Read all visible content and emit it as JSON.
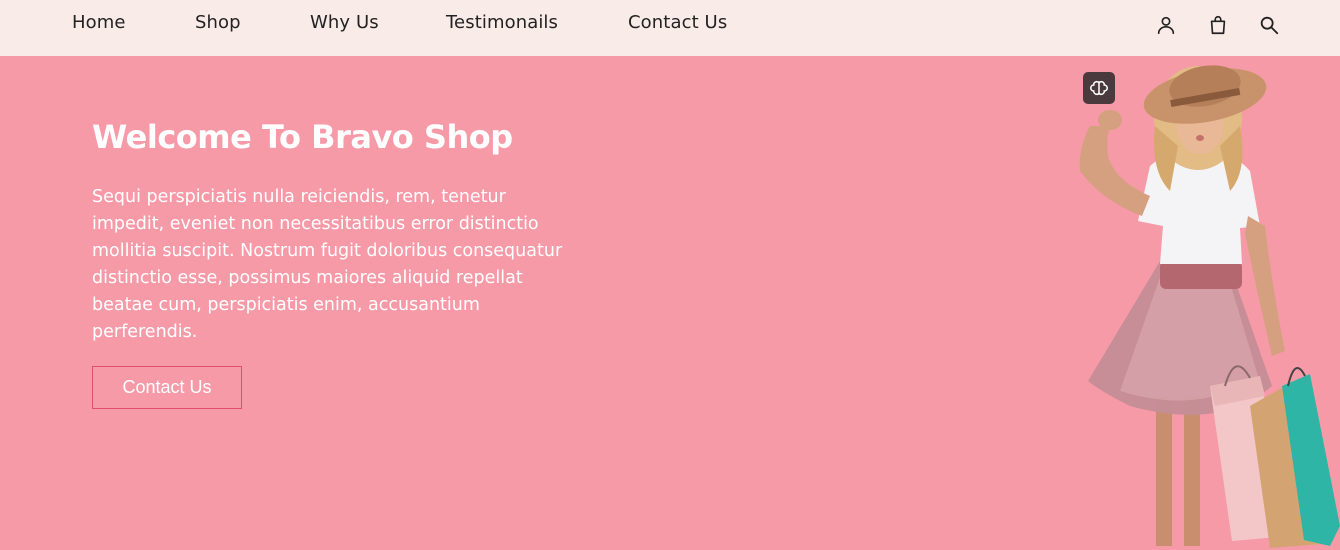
{
  "nav": {
    "links": [
      {
        "label": "Home"
      },
      {
        "label": "Shop"
      },
      {
        "label": "Why Us"
      },
      {
        "label": "Testimonails"
      },
      {
        "label": "Contact Us"
      }
    ],
    "icons": [
      "user-icon",
      "shopping-bag-icon",
      "search-icon"
    ]
  },
  "hero": {
    "title": "Welcome To Bravo Shop",
    "text": "Sequi perspiciatis nulla reiciendis, rem, tenetur impedit, eveniet non necessitatibus error distinctio mollitia suscipit. Nostrum fugit doloribus consequatur distinctio esse, possimus maiores aliquid repellat beatae cum, perspiciatis enim, accusantium perferendis.",
    "button_label": "Contact Us",
    "image_subject": "girl-with-shopping-bags"
  },
  "colors": {
    "nav_background": "#f9ebe7",
    "hero_background": "#f79aa8",
    "button_border": "#e0506e",
    "text_light": "#ffffff"
  }
}
